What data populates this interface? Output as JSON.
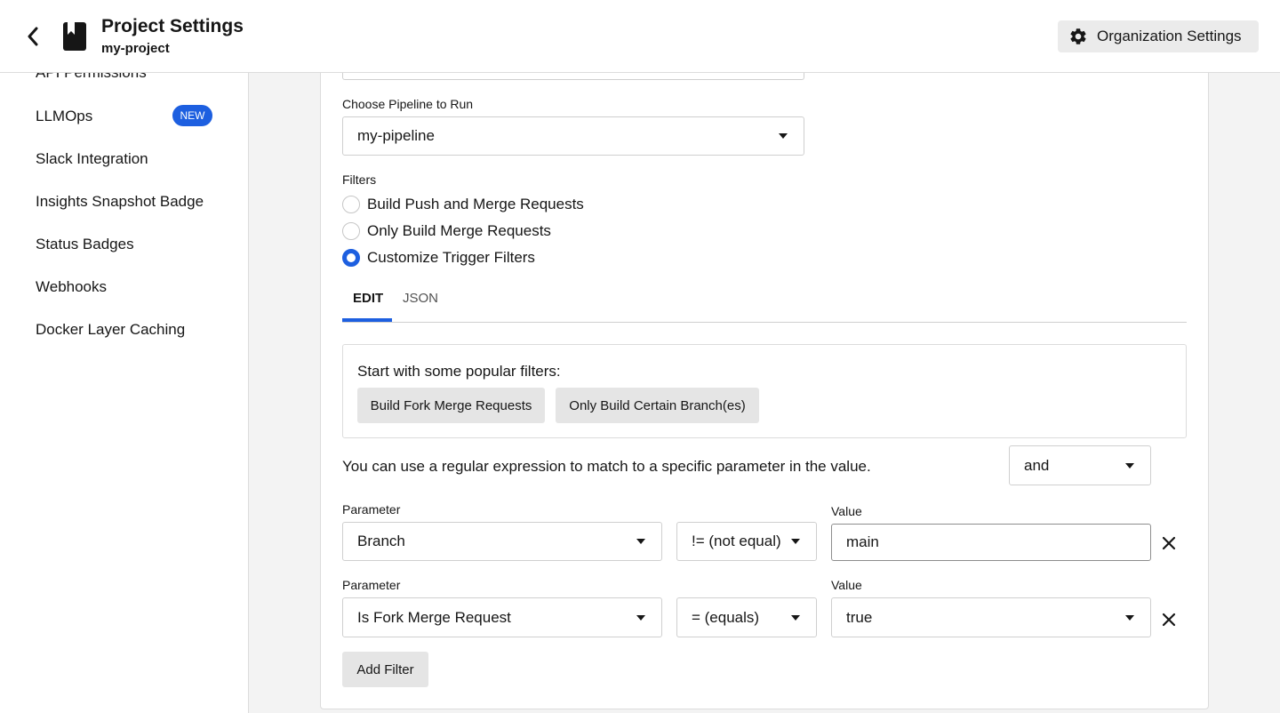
{
  "header": {
    "title": "Project Settings",
    "subtitle": "my-project",
    "org_settings_label": "Organization Settings"
  },
  "sidebar": {
    "items": [
      {
        "label": "API Permissions"
      },
      {
        "label": "LLMOps",
        "badge": "NEW"
      },
      {
        "label": "Slack Integration"
      },
      {
        "label": "Insights Snapshot Badge"
      },
      {
        "label": "Status Badges"
      },
      {
        "label": "Webhooks"
      },
      {
        "label": "Docker Layer Caching"
      }
    ]
  },
  "form": {
    "pipeline_label": "Choose Pipeline to Run",
    "pipeline_value": "my-pipeline",
    "filters_label": "Filters",
    "filter_options": [
      {
        "label": "Build Push and Merge Requests",
        "checked": false
      },
      {
        "label": "Only Build Merge Requests",
        "checked": false
      },
      {
        "label": "Customize Trigger Filters",
        "checked": true
      }
    ],
    "tabs": [
      {
        "label": "EDIT",
        "active": true
      },
      {
        "label": "JSON",
        "active": false
      }
    ],
    "popular_title": "Start with some popular filters:",
    "popular_buttons": [
      "Build Fork Merge Requests",
      "Only Build Certain Branch(es)"
    ],
    "regex_hint": "You can use a regular expression to match to a specific parameter in the value.",
    "logic_value": "and",
    "filter_rows": [
      {
        "param_label": "Parameter",
        "param_value": "Branch",
        "operator": "!= (not equal)",
        "value_label": "Value",
        "value": "main",
        "value_type": "input"
      },
      {
        "param_label": "Parameter",
        "param_value": "Is Fork Merge Request",
        "operator": "= (equals)",
        "value_label": "Value",
        "value": "true",
        "value_type": "select"
      }
    ],
    "add_filter_label": "Add Filter"
  },
  "colors": {
    "accent": "#1d5fe0",
    "button_gray": "#e5e5e5",
    "border": "#dcdcdc"
  },
  "icons": {
    "back": "chevron-left-icon",
    "project": "book-icon",
    "settings": "gear-icon",
    "remove": "close-icon"
  }
}
